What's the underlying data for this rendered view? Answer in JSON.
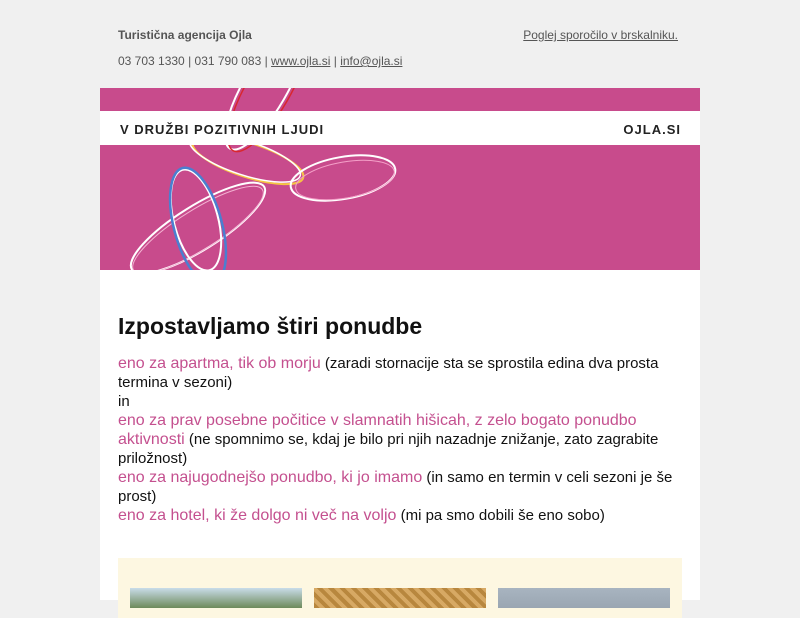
{
  "header": {
    "agency": "Turistična agencija Ojla",
    "phones": "03 703 1330 | 031 790 083 | ",
    "website": "www.ojla.si",
    "separator": " | ",
    "email": "info@ojla.si",
    "view_in_browser": "Poglej sporočilo v brskalniku."
  },
  "banner": {
    "left_text": "V DRUŽBI POZITIVNIH LJUDI",
    "right_text": "OJLA.SI",
    "background_color": "#c84b8c"
  },
  "main": {
    "title": "Izpostavljamo štiri ponudbe",
    "offers": [
      {
        "link": "eno za apartma, tik ob morju",
        "note": " (zaradi stornacije sta se sprostila edina dva prosta termina v sezoni)"
      },
      {
        "link": "eno za prav posebne počitice v slamnatih hišicah, z zelo bogato ponudbo aktivnosti",
        "note": " (ne spomnimo se, kdaj je bilo pri njih nazadnje znižanje, zato zagrabite priložnost)"
      },
      {
        "link": "eno za najugodnejšo ponudbo, ki jo imamo",
        "note": " (in samo en termin v celi sezoni je še prost)"
      },
      {
        "link": "eno za hotel, ki že dolgo ni več na voljo",
        "note": " (mi pa smo dobili še eno sobo)"
      }
    ],
    "connector": "in",
    "accent_color": "#c4508f"
  }
}
